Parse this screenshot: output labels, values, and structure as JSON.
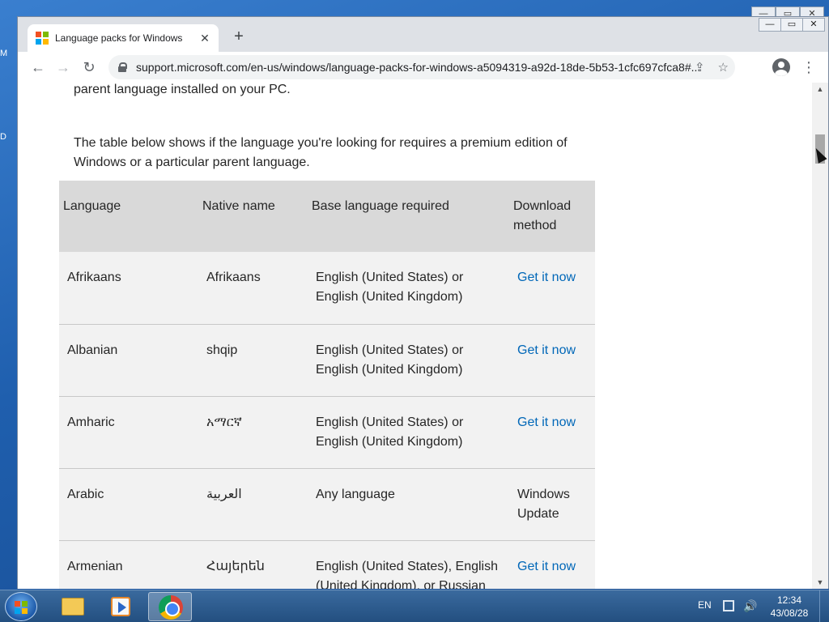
{
  "browser": {
    "tab_title": "Language packs for Windows",
    "tab_close": "✕",
    "new_tab": "+",
    "url": "support.microsoft.com/en-us/windows/language-packs-for-windows-a5094319-a92d-18de-5b53-1cfc697cfca8#...",
    "back": "←",
    "forward": "→",
    "reload": "↻",
    "share": "⇪",
    "star": "☆",
    "menu": "⋮",
    "window_controls": [
      "—",
      "▭",
      "✕"
    ]
  },
  "desktop": {
    "fragments": [
      "M",
      "D"
    ]
  },
  "article": {
    "para_top": "parent language installed on your PC.",
    "para_table_intro": "The table below shows if the language you're looking for requires a premium edition of Windows or a particular parent language."
  },
  "table": {
    "headers": [
      "Language",
      "Native name",
      "Base language required",
      "Download method"
    ],
    "rows": [
      {
        "language": "Afrikaans",
        "native": "Afrikaans",
        "base": "English (United States) or English (United Kingdom)",
        "method": "Get it now",
        "link": true
      },
      {
        "language": "Albanian",
        "native": "shqip",
        "base": "English (United States) or English (United Kingdom)",
        "method": "Get it now",
        "link": true
      },
      {
        "language": "Amharic",
        "native": "አማርኛ",
        "base": "English (United States) or English (United Kingdom)",
        "method": "Get it now",
        "link": true
      },
      {
        "language": "Arabic",
        "native": "العربية",
        "base": "Any language",
        "method": "Windows Update",
        "link": false
      },
      {
        "language": "Armenian",
        "native": "Հայերեն",
        "base": "English (United States), English (United Kingdom), or Russian",
        "method": "Get it now",
        "link": true
      }
    ]
  },
  "taskbar": {
    "language": "EN",
    "time": "12:34",
    "date": "43/08/28",
    "volume": "🔊"
  },
  "colors": {
    "link": "#0067b8",
    "table_header_bg": "#d9d9d9",
    "table_row_bg": "#f2f2f2",
    "ms_logo": [
      "#f25022",
      "#7fba00",
      "#00a4ef",
      "#ffb900"
    ]
  }
}
